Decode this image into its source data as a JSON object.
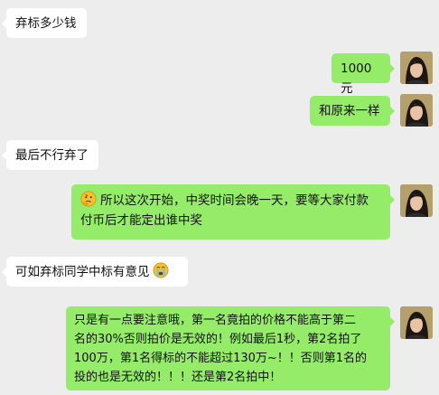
{
  "messages": [
    {
      "side": "left",
      "text": "弃标多少钱"
    },
    {
      "side": "right",
      "text": "1000元"
    },
    {
      "side": "right",
      "text": "和原来一样"
    },
    {
      "side": "left",
      "text": "最后不行弃了"
    },
    {
      "side": "right",
      "emoji": "thinking-face",
      "lines": [
        "所以这次开始，中奖时间会晚一天，要等大家付款",
        "付币后才能定出谁中奖"
      ]
    },
    {
      "side": "left",
      "text": "可如弃标同学中标有意见",
      "emoji": "crying-face"
    },
    {
      "side": "right",
      "lines": [
        "只是有一点要注意哦，第一名竟拍的价格不能高于第二",
        "名的30%否则拍价是无效的！例如最后1秒，第2名拍了",
        "100万，第1名得标的不能超过130万~！！否则第1名的",
        "投的也是无效的！！！还是第2名拍中！"
      ]
    }
  ],
  "colors": {
    "background": "#ededed",
    "self_bubble": "#95ec69",
    "other_bubble": "#ffffff"
  }
}
